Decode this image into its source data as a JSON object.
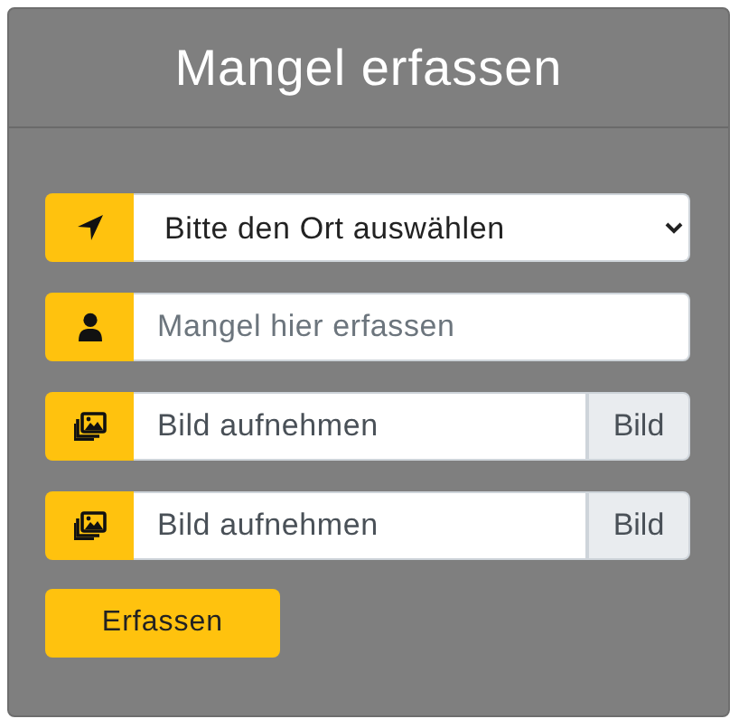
{
  "header": {
    "title": "Mangel erfassen"
  },
  "fields": [
    {
      "kind": "select",
      "value": "Bitte den Ort auswählen"
    },
    {
      "kind": "text",
      "placeholder": "Mangel hier erfassen"
    },
    {
      "kind": "file",
      "value": "Bild aufnehmen",
      "button": "Bild"
    },
    {
      "kind": "file",
      "value": "Bild aufnehmen",
      "button": "Bild"
    }
  ],
  "submit": "Erfassen"
}
